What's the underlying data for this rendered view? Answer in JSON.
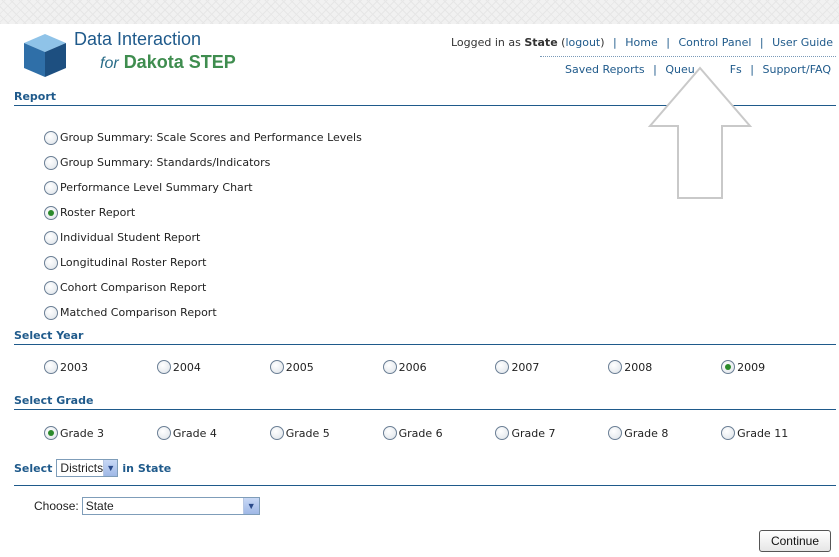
{
  "app": {
    "title": "Data Interaction",
    "subtitle_for": "for",
    "subtitle_brand": "Dakota STEP"
  },
  "topnav": {
    "logged_in_prefix": "Logged in as",
    "user": "State",
    "logout": "logout",
    "home": "Home",
    "control_panel": "Control Panel",
    "user_guide": "User Guide"
  },
  "subnav": {
    "saved_reports": "Saved Reports",
    "queue_pdfs": "Queu          Fs",
    "support_faq": "Support/FAQ"
  },
  "report": {
    "section_title": "Report",
    "options": [
      {
        "label": "Group Summary: Scale Scores and Performance Levels",
        "checked": false
      },
      {
        "label": "Group Summary: Standards/Indicators",
        "checked": false
      },
      {
        "label": "Performance Level Summary Chart",
        "checked": false
      },
      {
        "label": "Roster Report",
        "checked": true
      },
      {
        "label": "Individual Student Report",
        "checked": false
      },
      {
        "label": "Longitudinal Roster Report",
        "checked": false
      },
      {
        "label": "Cohort Comparison Report",
        "checked": false
      },
      {
        "label": "Matched Comparison Report",
        "checked": false
      }
    ]
  },
  "year": {
    "section_title": "Select Year",
    "options": [
      {
        "label": "2003",
        "checked": false
      },
      {
        "label": "2004",
        "checked": false
      },
      {
        "label": "2005",
        "checked": false
      },
      {
        "label": "2006",
        "checked": false
      },
      {
        "label": "2007",
        "checked": false
      },
      {
        "label": "2008",
        "checked": false
      },
      {
        "label": "2009",
        "checked": true
      }
    ]
  },
  "grade": {
    "section_title": "Select Grade",
    "options": [
      {
        "label": "Grade 3",
        "checked": true
      },
      {
        "label": "Grade 4",
        "checked": false
      },
      {
        "label": "Grade 5",
        "checked": false
      },
      {
        "label": "Grade 6",
        "checked": false
      },
      {
        "label": "Grade 7",
        "checked": false
      },
      {
        "label": "Grade 8",
        "checked": false
      },
      {
        "label": "Grade 11",
        "checked": false
      }
    ]
  },
  "scope": {
    "select_prefix": "Select",
    "selected": "Districts",
    "suffix": "in State"
  },
  "choose": {
    "label": "Choose:",
    "selected": "State"
  },
  "continue_label": "Continue",
  "colors": {
    "accent": "#1f5a8b",
    "checked_dot": "#2b8a2b",
    "brand_green": "#3f8d4f"
  }
}
